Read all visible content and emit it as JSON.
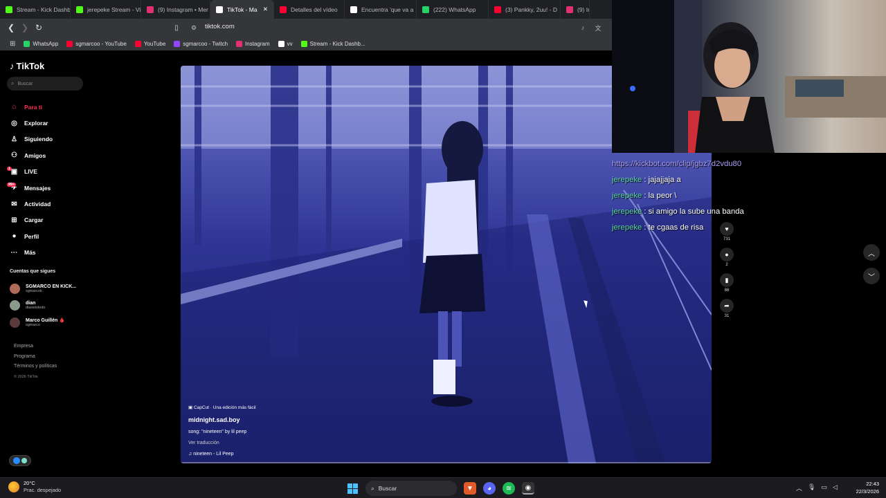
{
  "browser": {
    "tabs": [
      {
        "label": "Stream - Kick Dashb",
        "color": "#53fc18"
      },
      {
        "label": "jerepeke Stream - Vi",
        "color": "#53fc18"
      },
      {
        "label": "(9) Instagram • Mer",
        "color": "#e1306c"
      },
      {
        "label": "TikTok - Ma",
        "color": "#ffffff",
        "active": true
      },
      {
        "label": "Detalles del vídeo",
        "color": "#ff0033"
      },
      {
        "label": "Encuentra 'que va a",
        "color": "#ffffff"
      },
      {
        "label": "(222) WhatsApp",
        "color": "#25d366"
      },
      {
        "label": "(3) Pankky, 2uu! - D",
        "color": "#ff0033"
      },
      {
        "label": "(9) Insta",
        "color": "#e1306c"
      }
    ],
    "close_glyph": "✕",
    "url": "tiktok.com",
    "bookmarks": [
      {
        "label": "WhatsApp",
        "color": "#25d366"
      },
      {
        "label": "sgmarcoo - YouTube",
        "color": "#ff0033"
      },
      {
        "label": "YouTube",
        "color": "#ff0033"
      },
      {
        "label": "sgmarcoo - Twitch",
        "color": "#9146ff"
      },
      {
        "label": "Instagram",
        "color": "#e1306c"
      },
      {
        "label": "vv",
        "color": "#ffffff"
      },
      {
        "label": "Stream - Kick Dashb...",
        "color": "#53fc18"
      }
    ]
  },
  "tiktok": {
    "logo": "TikTok",
    "search_placeholder": "Buscar",
    "nav": [
      {
        "label": "Para ti",
        "icon": "⌂"
      },
      {
        "label": "Explorar",
        "icon": "◎"
      },
      {
        "label": "Siguiendo",
        "icon": "♙"
      },
      {
        "label": "Amigos",
        "icon": "⚇"
      },
      {
        "label": "LIVE",
        "icon": "▣"
      },
      {
        "label": "Mensajes",
        "icon": "✈",
        "badge": "1"
      },
      {
        "label": "Actividad",
        "icon": "✉",
        "badge": "99+"
      },
      {
        "label": "Cargar",
        "icon": "⊞"
      },
      {
        "label": "Perfil",
        "icon": "●"
      },
      {
        "label": "Más",
        "icon": "···"
      }
    ],
    "following_header": "Cuentas que sigues",
    "following": [
      {
        "name": "SGMARCO EN KICK...",
        "handle": "sgmarcok",
        "color": "#b06a5a"
      },
      {
        "name": "dian",
        "handle": "dianetoledo",
        "color": "#8a9a8a"
      },
      {
        "name": "Marco Guillén 🩸",
        "handle": "sgmarco",
        "color": "#5a3a3a"
      }
    ],
    "footer": [
      "Empresa",
      "Programa",
      "Términos y políticas"
    ],
    "copyright": "© 2026 TikTok",
    "video": {
      "capcut": "CapCut · Una edición más fácil",
      "author": "midnight.sad.boy",
      "description": "song: \"nineteen\" by lil peep",
      "translate": "Ver traducción",
      "music": "nineteen - Lil Peep"
    },
    "actions": [
      {
        "name": "like",
        "icon": "♥",
        "count": "731"
      },
      {
        "name": "comment",
        "icon": "●",
        "count": "2"
      },
      {
        "name": "save",
        "icon": "▮",
        "count": "86"
      },
      {
        "name": "share",
        "icon": "➦",
        "count": "31"
      }
    ]
  },
  "chat": {
    "link": "https://kickbot.com/clip/jgbz7d2vdu80",
    "messages": [
      {
        "user": "jerepeke",
        "text": ": jajajjaja a"
      },
      {
        "user": "jerepeke",
        "text": ": la peor \\"
      },
      {
        "user": "jerepeke",
        "text": ": si amigo la sube una banda"
      },
      {
        "user": "jerepeke",
        "text": ": te cgaas de risa"
      }
    ]
  },
  "taskbar": {
    "temp": "20°C",
    "weather": "Prac. despejado",
    "search": "Buscar",
    "time": "22:43",
    "date": "22/3/2026"
  }
}
